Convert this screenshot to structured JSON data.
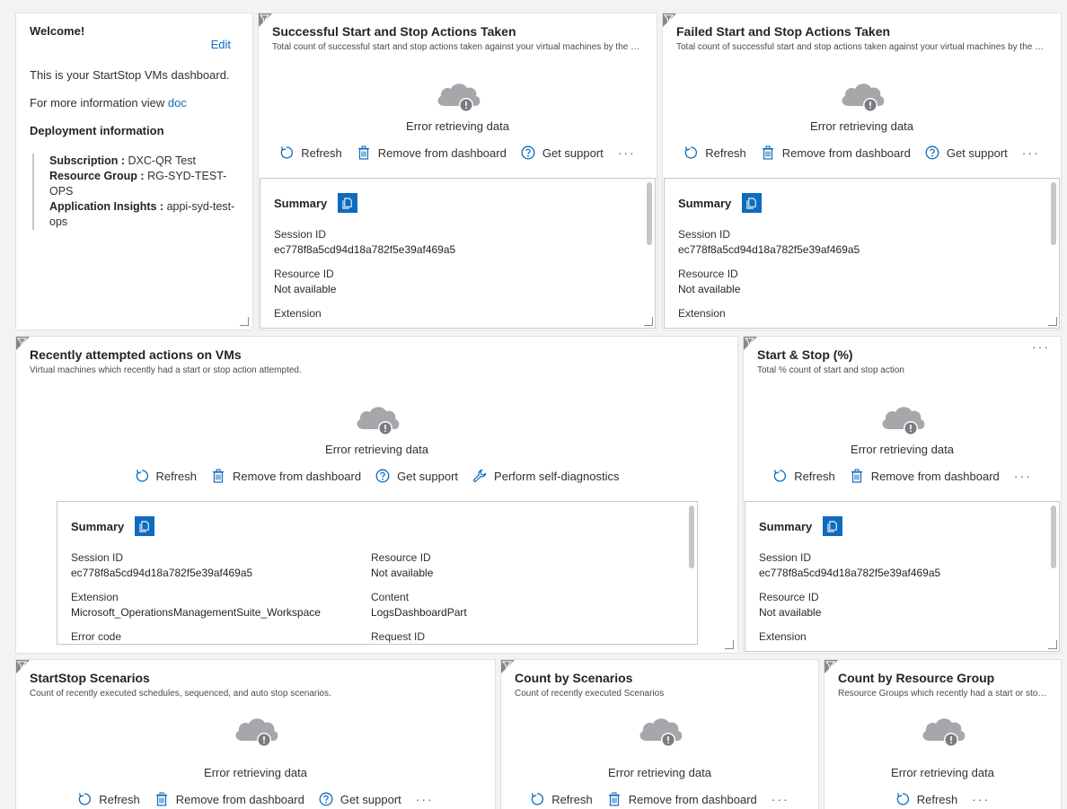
{
  "welcome": {
    "title": "Welcome!",
    "edit": "Edit",
    "line1": "This is your StartStop VMs dashboard.",
    "line2_prefix": "For more information view",
    "line2_link": "doc",
    "deployment_title": "Deployment information",
    "subscription_label": "Subscription :",
    "subscription_value": "DXC-QR Test",
    "rg_label": "Resource Group :",
    "rg_value": "RG-SYD-TEST-OPS",
    "ai_label": "Application Insights :",
    "ai_value": "appi-syd-test-ops"
  },
  "common": {
    "error": "Error retrieving data",
    "refresh": "Refresh",
    "remove": "Remove from dashboard",
    "support": "Get support",
    "diagnostics": "Perform self-diagnostics",
    "more": "···",
    "summary": "Summary",
    "session_id_label": "Session ID",
    "session_id_value": "ec778f8a5cd94d18a782f5e39af469a5",
    "resource_id_label": "Resource ID",
    "resource_id_value": "Not available",
    "extension_label": "Extension",
    "extension_value": "Microsoft_OperationsManagementSuite_Workspace",
    "content_label": "Content",
    "content_value": "LogsDashboardPart",
    "error_code_label": "Error code",
    "request_id_label": "Request ID"
  },
  "tiles": {
    "success": {
      "title": "Successful Start and Stop Actions Taken",
      "subtitle": "Total count of successful start and stop actions taken against your virtual machines by the S..."
    },
    "failed": {
      "title": "Failed Start and Stop Actions Taken",
      "subtitle": "Total count of successful start and stop actions taken against your virtual machines by the S..."
    },
    "recent": {
      "title": "Recently attempted actions on VMs",
      "subtitle": "Virtual machines which recently had a start or stop action attempted."
    },
    "percent": {
      "title": "Start & Stop (%)",
      "subtitle": "Total % count of start and stop action"
    },
    "scenarios": {
      "title": "StartStop Scenarios",
      "subtitle": "Count of recently executed schedules, sequenced, and auto stop scenarios."
    },
    "count_scen": {
      "title": "Count by Scenarios",
      "subtitle": "Count of recently executed Scenarios"
    },
    "count_rg": {
      "title": "Count by Resource Group",
      "subtitle": "Resource Groups which recently had a start or stop..."
    }
  },
  "colors": {
    "accent": "#0f6cbd",
    "cloud": "#a5a7ab",
    "warn": "#7a7c80"
  }
}
